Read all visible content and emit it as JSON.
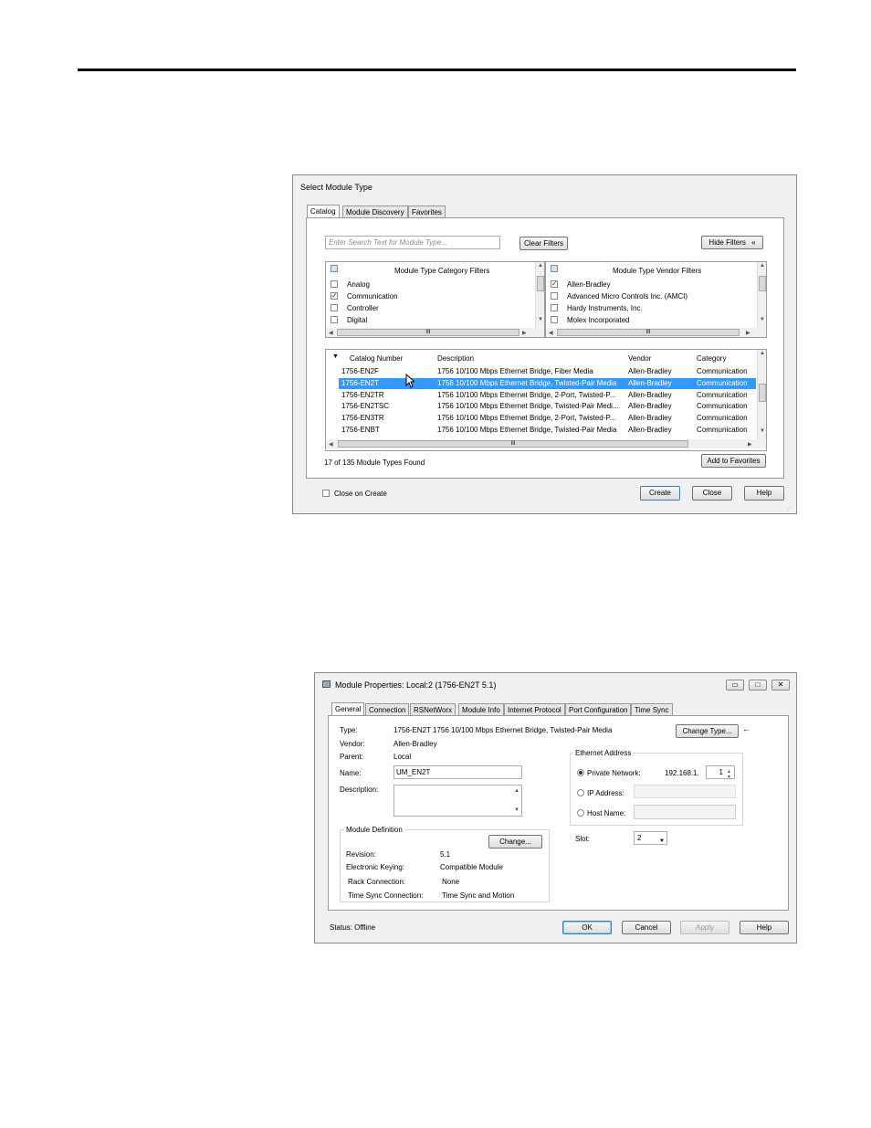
{
  "dialog1": {
    "title": "Select Module Type",
    "tabs": [
      "Catalog",
      "Module Discovery",
      "Favorites"
    ],
    "search_placeholder": "Enter Search Text for Module Type...",
    "clear_filters": "Clear Filters",
    "hide_filters": "Hide Filters",
    "hide_filters_icon": "«",
    "category_header": "Module Type Category Filters",
    "categories": [
      {
        "label": "Analog",
        "checked": false
      },
      {
        "label": "Communication",
        "checked": true
      },
      {
        "label": "Controller",
        "checked": false
      },
      {
        "label": "Digital",
        "checked": false
      }
    ],
    "vendor_header": "Module Type Vendor Filters",
    "vendors": [
      {
        "label": "Allen-Bradley",
        "checked": true
      },
      {
        "label": "Advanced Micro Controls Inc. (AMCI)",
        "checked": false
      },
      {
        "label": "Hardy Instruments, Inc.",
        "checked": false
      },
      {
        "label": "Molex Incorporated",
        "checked": false
      }
    ],
    "columns": [
      "Catalog Number",
      "Description",
      "Vendor",
      "Category"
    ],
    "rows": [
      [
        "1756-EN2F",
        "1756 10/100 Mbps Ethernet Bridge, Fiber Media",
        "Allen-Bradley",
        "Communication"
      ],
      [
        "1756-EN2T",
        "1756 10/100 Mbps Ethernet Bridge, Twisted-Pair Media",
        "Allen-Bradley",
        "Communication"
      ],
      [
        "1756-EN2TR",
        "1756 10/100 Mbps Ethernet Bridge, 2-Port, Twisted-P...",
        "Allen-Bradley",
        "Communication"
      ],
      [
        "1756-EN2TSC",
        "1756 10/100 Mbps Ethernet Bridge, Twisted-Pair Medi...",
        "Allen-Bradley",
        "Communication"
      ],
      [
        "1756-EN3TR",
        "1756 10/100 Mbps Ethernet Bridge, 2-Port, Twisted-P...",
        "Allen-Bradley",
        "Communication"
      ],
      [
        "1756-ENBT",
        "1756 10/100 Mbps Ethernet Bridge, Twisted-Pair Media",
        "Allen-Bradley",
        "Communication"
      ]
    ],
    "selected_row": 1,
    "found_text": "17 of 135 Module Types Found",
    "add_favorites": "Add to Favorites",
    "close_on_create": "Close on Create",
    "create": "Create",
    "close": "Close",
    "help": "Help",
    "scroll_grip": "III"
  },
  "dialog2": {
    "title": "Module Properties: Local:2 (1756-EN2T 5.1)",
    "tabs": [
      "General",
      "Connection",
      "RSNetWorx",
      "Module Info",
      "Internet Protocol",
      "Port Configuration",
      "Time Sync"
    ],
    "type_label": "Type:",
    "type_value": "1756-EN2T 1756 10/100 Mbps Ethernet Bridge, Twisted-Pair Media",
    "vendor_label": "Vendor:",
    "vendor_value": "Allen-Bradley",
    "parent_label": "Parent:",
    "parent_value": "Local",
    "name_label": "Name:",
    "name_value": "UM_EN2T",
    "description_label": "Description:",
    "change_type": "Change Type...",
    "ethernet_address": "Ethernet Address",
    "private_network": "Private Network:",
    "private_prefix": "192.168.1.",
    "private_suffix": "1",
    "ip_address": "IP Address:",
    "host_name": "Host Name:",
    "slot_label": "Slot:",
    "slot_value": "2",
    "module_definition": "Module Definition",
    "change": "Change...",
    "revision_label": "Revision:",
    "revision_value": "5.1",
    "keying_label": "Electronic Keying:",
    "keying_value": "Compatible Module",
    "rack_label": "Rack Connection:",
    "rack_value": "None",
    "timesync_label": "Time Sync Connection:",
    "timesync_value": "Time Sync and Motion",
    "status": "Status:  Offline",
    "ok": "OK",
    "cancel": "Cancel",
    "apply": "Apply",
    "help": "Help"
  }
}
